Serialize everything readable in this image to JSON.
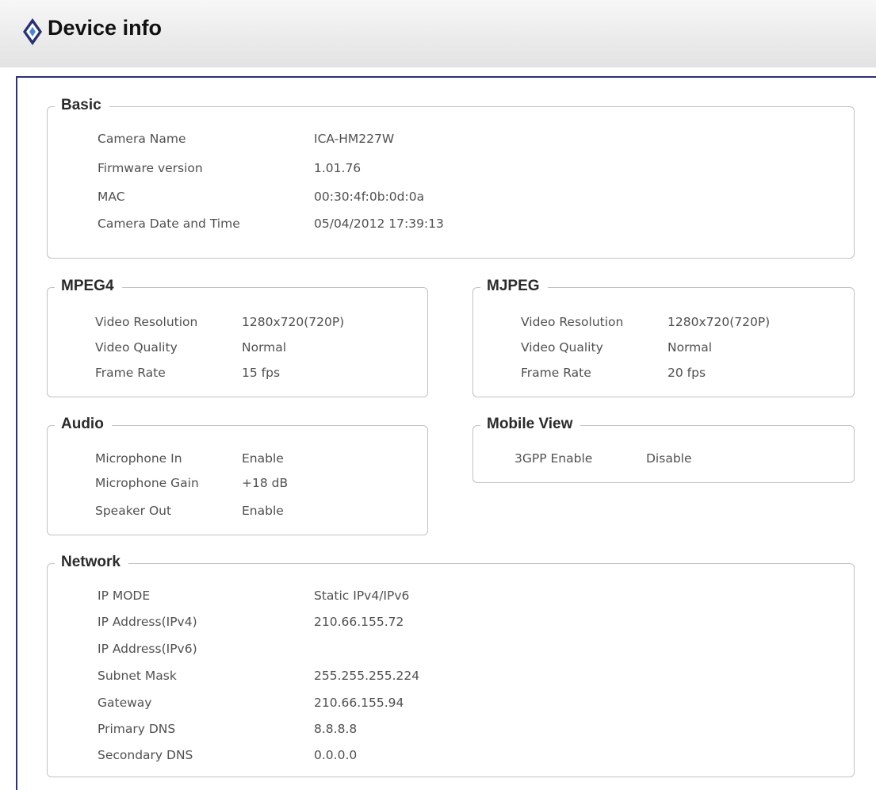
{
  "header": {
    "title": "Device info",
    "icon": "device-info-icon",
    "accent_color": "#2d3178"
  },
  "basic": {
    "legend": "Basic",
    "rows": [
      {
        "label": "Camera Name",
        "value": "ICA-HM227W"
      },
      {
        "label": "Firmware version",
        "value": "1.01.76"
      },
      {
        "label": "MAC",
        "value": "00:30:4f:0b:0d:0a"
      },
      {
        "label": "Camera Date and Time",
        "value": "05/04/2012 17:39:13"
      }
    ]
  },
  "mpeg4": {
    "legend": "MPEG4",
    "rows": [
      {
        "label": "Video Resolution",
        "value": "1280x720(720P)"
      },
      {
        "label": "Video Quality",
        "value": "Normal"
      },
      {
        "label": "Frame Rate",
        "value": "15 fps"
      }
    ]
  },
  "mjpeg": {
    "legend": "MJPEG",
    "rows": [
      {
        "label": "Video Resolution",
        "value": "1280x720(720P)"
      },
      {
        "label": "Video Quality",
        "value": "Normal"
      },
      {
        "label": "Frame Rate",
        "value": "20 fps"
      }
    ]
  },
  "audio": {
    "legend": "Audio",
    "rows": [
      {
        "label": "Microphone In",
        "value": "Enable"
      },
      {
        "label": "Microphone Gain",
        "value": "+18 dB"
      },
      {
        "label": "Speaker Out",
        "value": "Enable"
      }
    ]
  },
  "mobile_view": {
    "legend": "Mobile View",
    "rows": [
      {
        "label": "3GPP Enable",
        "value": "Disable"
      }
    ]
  },
  "network": {
    "legend": "Network",
    "rows": [
      {
        "label": "IP MODE",
        "value": "Static IPv4/IPv6"
      },
      {
        "label": "IP Address(IPv4)",
        "value": "210.66.155.72"
      },
      {
        "label": "IP Address(IPv6)",
        "value": ""
      },
      {
        "label": "Subnet Mask",
        "value": "255.255.255.224"
      },
      {
        "label": "Gateway",
        "value": "210.66.155.94"
      },
      {
        "label": "Primary DNS",
        "value": "8.8.8.8"
      },
      {
        "label": "Secondary DNS",
        "value": "0.0.0.0"
      }
    ]
  }
}
